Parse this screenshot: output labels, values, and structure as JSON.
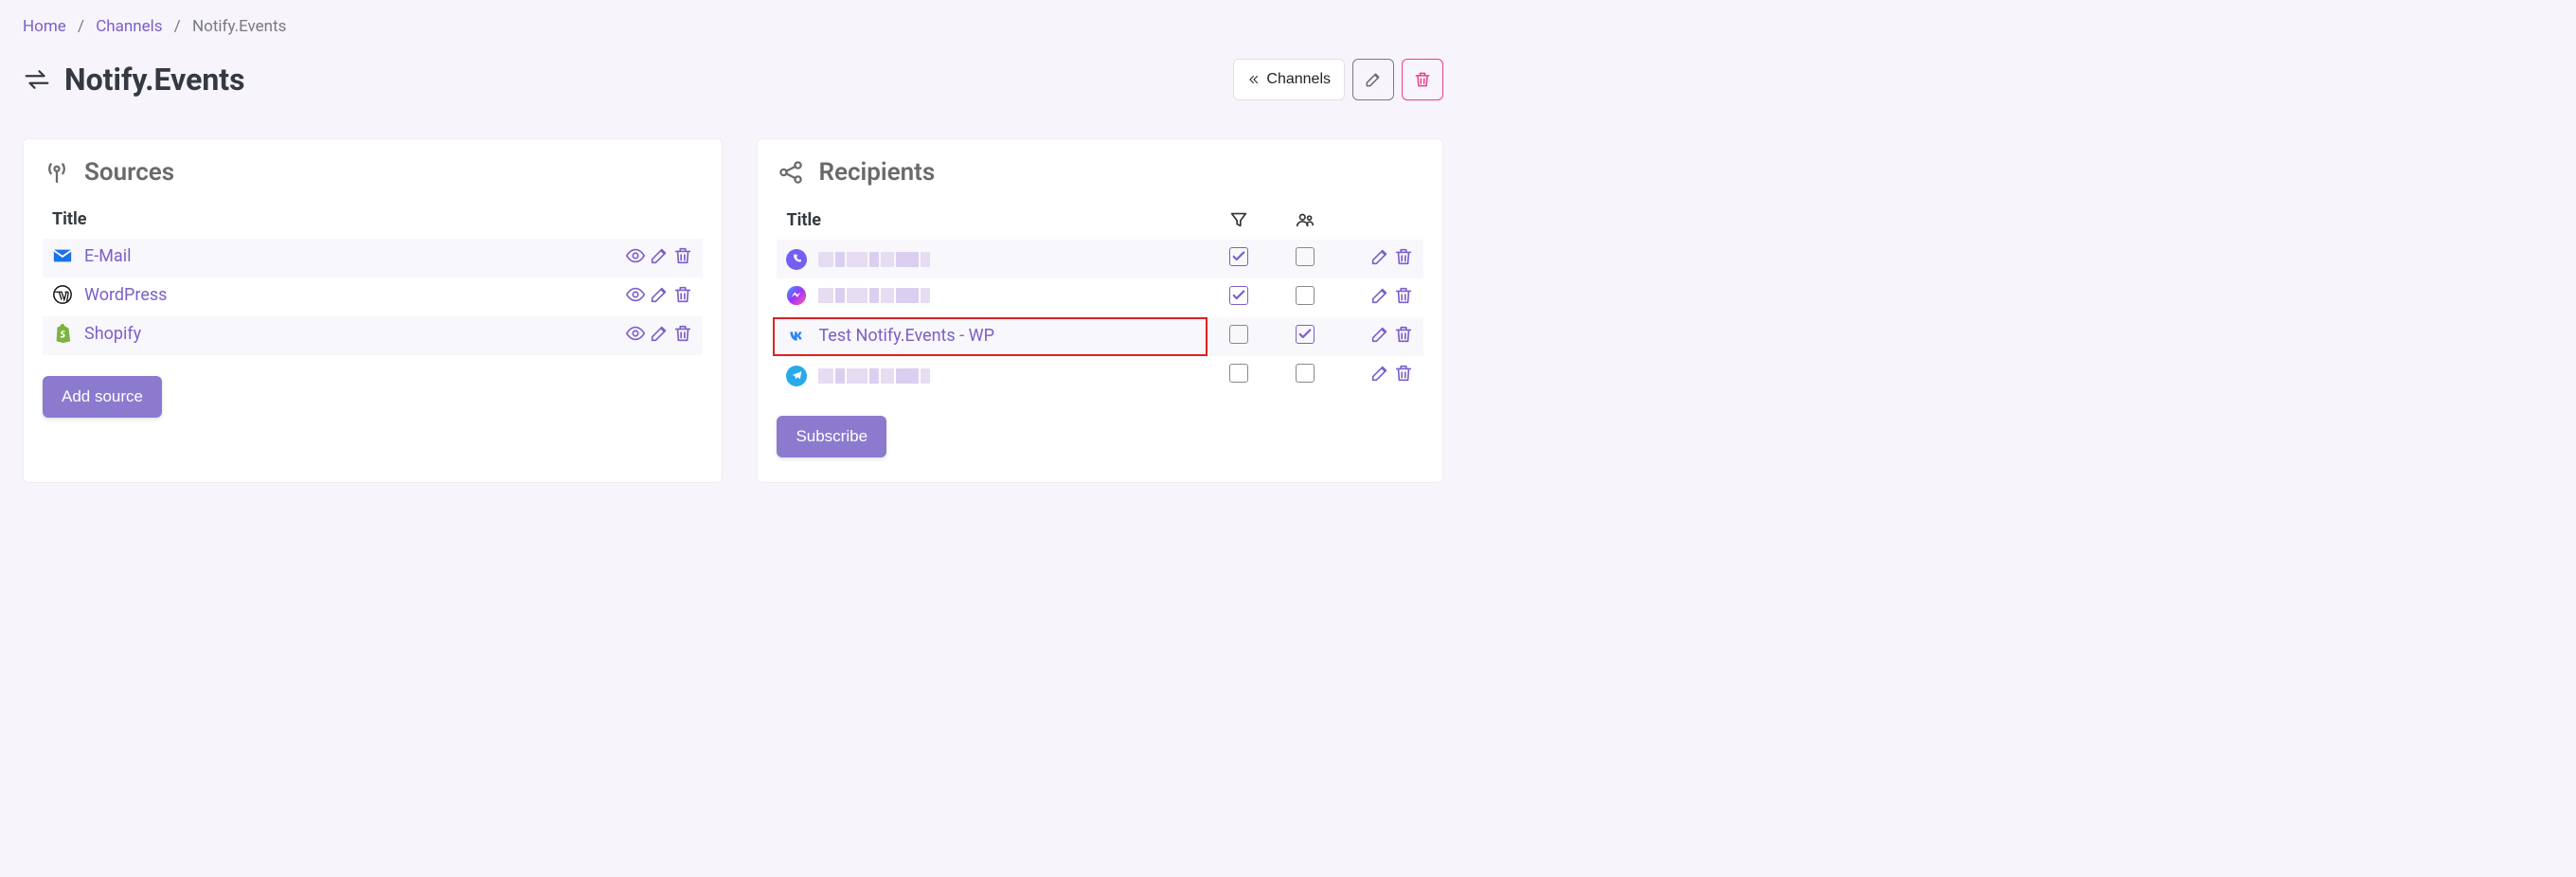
{
  "breadcrumbs": {
    "home": "Home",
    "channels": "Channels",
    "current": "Notify.Events"
  },
  "page_title": "Notify.Events",
  "header_actions": {
    "channels_button": "Channels"
  },
  "sources": {
    "title": "Sources",
    "column_title": "Title",
    "items": [
      {
        "label": "E-Mail",
        "icon": "email"
      },
      {
        "label": "WordPress",
        "icon": "wordpress"
      },
      {
        "label": "Shopify",
        "icon": "shopify"
      }
    ],
    "add_button": "Add source"
  },
  "recipients": {
    "title": "Recipients",
    "column_title": "Title",
    "items": [
      {
        "label": "",
        "icon": "viber",
        "blurred": true,
        "check1": true,
        "check2": false,
        "highlight": false,
        "strike": false
      },
      {
        "label": "",
        "icon": "messenger",
        "blurred": true,
        "check1": true,
        "check2": false,
        "highlight": false,
        "strike": false
      },
      {
        "label": "Test Notify.Events - WP",
        "icon": "vk",
        "blurred": false,
        "check1": false,
        "check2": true,
        "highlight": true,
        "strike": true
      },
      {
        "label": "",
        "icon": "telegram",
        "blurred": true,
        "check1": false,
        "check2": false,
        "highlight": false,
        "strike": false
      }
    ],
    "subscribe_button": "Subscribe"
  }
}
